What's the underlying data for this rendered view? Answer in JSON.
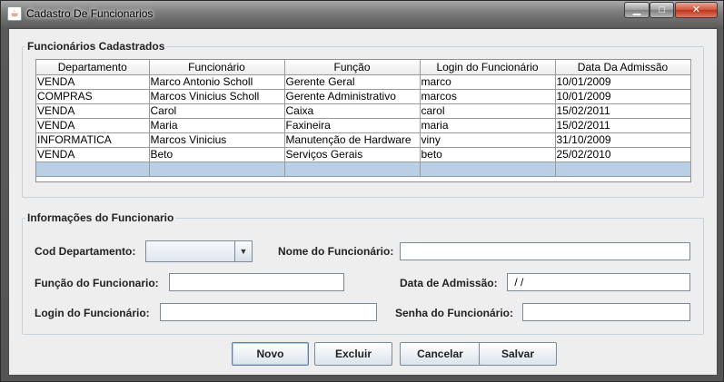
{
  "window": {
    "title": "Cadastro De Funcionarios",
    "icon": "java-cup-icon",
    "controls": {
      "minimize": "▁",
      "maximize": "□",
      "close": "✕"
    }
  },
  "table_section": {
    "legend": "Funcionários Cadastrados",
    "columns": [
      "Departamento",
      "Funcionário",
      "Função",
      "Login do Funcionário",
      "Data Da Admissão"
    ],
    "rows": [
      [
        "VENDA",
        "Marco Antonio Scholl",
        "Gerente Geral",
        "marco",
        "10/01/2009"
      ],
      [
        "COMPRAS",
        "Marcos Vinicius Scholl",
        "Gerente Administrativo",
        "marcos",
        "10/01/2009"
      ],
      [
        "VENDA",
        "Carol",
        "Caixa",
        "carol",
        "15/02/2011"
      ],
      [
        "VENDA",
        "Maria",
        "Faxineira",
        "maria",
        "15/02/2011"
      ],
      [
        "INFORMATICA",
        "Marcos Vinicius",
        "Manutenção de Hardware",
        "viny",
        "31/10/2009"
      ],
      [
        "VENDA",
        "Beto",
        "Serviços Gerais",
        "beto",
        "25/02/2010"
      ]
    ]
  },
  "form_section": {
    "legend": "Informações do Funcionario",
    "cod_departamento_label": "Cod Departamento:",
    "cod_departamento_value": "",
    "nome_label": "Nome do Funcionário:",
    "nome_value": "",
    "funcao_label": "Função do Funcionario:",
    "funcao_value": "",
    "data_admissao_label": "Data de Admissão:",
    "data_admissao_value": " / /",
    "login_label": "Login do Funcionário:",
    "login_value": "",
    "senha_label": "Senha do Funcionário:",
    "senha_value": ""
  },
  "buttons": {
    "novo": "Novo",
    "excluir": "Excluir",
    "cancelar": "Cancelar",
    "salvar": "Salvar"
  }
}
